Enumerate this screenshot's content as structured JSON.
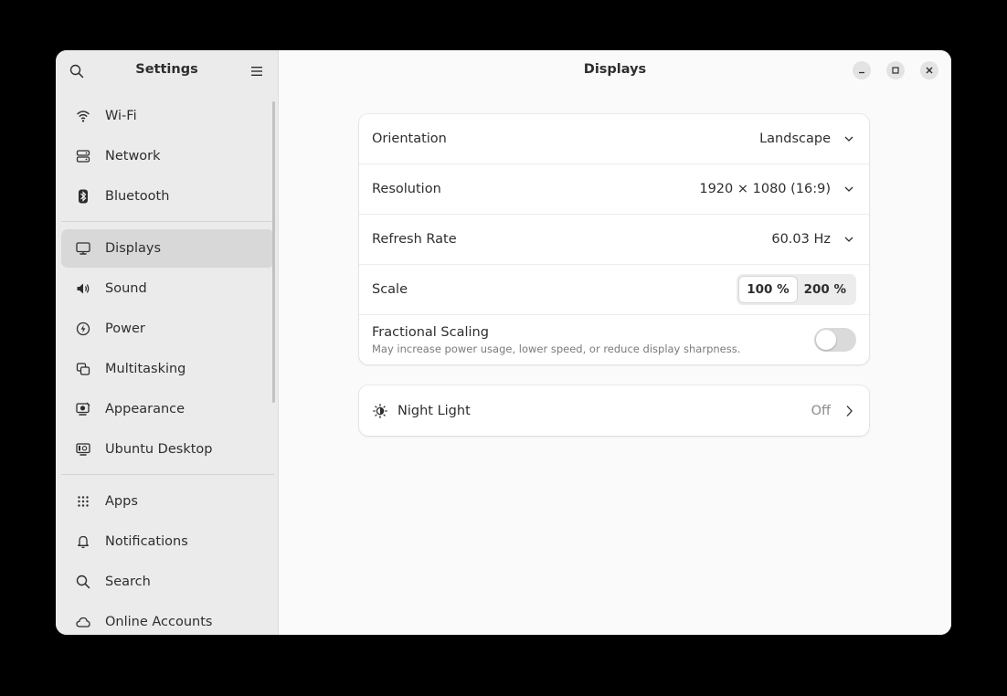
{
  "sidebar": {
    "title": "Settings",
    "groups": [
      [
        {
          "label": "Wi-Fi",
          "icon": "wifi-icon"
        },
        {
          "label": "Network",
          "icon": "network-icon"
        },
        {
          "label": "Bluetooth",
          "icon": "bluetooth-icon"
        }
      ],
      [
        {
          "label": "Displays",
          "icon": "display-icon",
          "active": true
        },
        {
          "label": "Sound",
          "icon": "speaker-icon"
        },
        {
          "label": "Power",
          "icon": "power-icon"
        },
        {
          "label": "Multitasking",
          "icon": "multitasking-icon"
        },
        {
          "label": "Appearance",
          "icon": "appearance-icon"
        },
        {
          "label": "Ubuntu Desktop",
          "icon": "ubuntu-desktop-icon"
        }
      ],
      [
        {
          "label": "Apps",
          "icon": "apps-grid-icon"
        },
        {
          "label": "Notifications",
          "icon": "bell-icon"
        },
        {
          "label": "Search",
          "icon": "search-icon"
        },
        {
          "label": "Online Accounts",
          "icon": "cloud-icon"
        }
      ]
    ]
  },
  "header": {
    "title": "Displays"
  },
  "settings": {
    "orientation": {
      "label": "Orientation",
      "value": "Landscape"
    },
    "resolution": {
      "label": "Resolution",
      "value": "1920 × 1080 (16:9)"
    },
    "refresh_rate": {
      "label": "Refresh Rate",
      "value": "60.03 Hz"
    },
    "scale": {
      "label": "Scale",
      "options": [
        "100 %",
        "200 %"
      ],
      "selected": "100 %"
    },
    "fractional_scaling": {
      "label": "Fractional Scaling",
      "description": "May increase power usage, lower speed, or reduce display sharpness.",
      "enabled": false
    }
  },
  "night_light": {
    "label": "Night Light",
    "value": "Off"
  },
  "colors": {
    "window_bg": "#fafafa",
    "sidebar_bg": "#ebebeb",
    "active_item_bg": "#d8d8d8",
    "card_bg": "#ffffff",
    "toggle_off": "#dadada"
  }
}
